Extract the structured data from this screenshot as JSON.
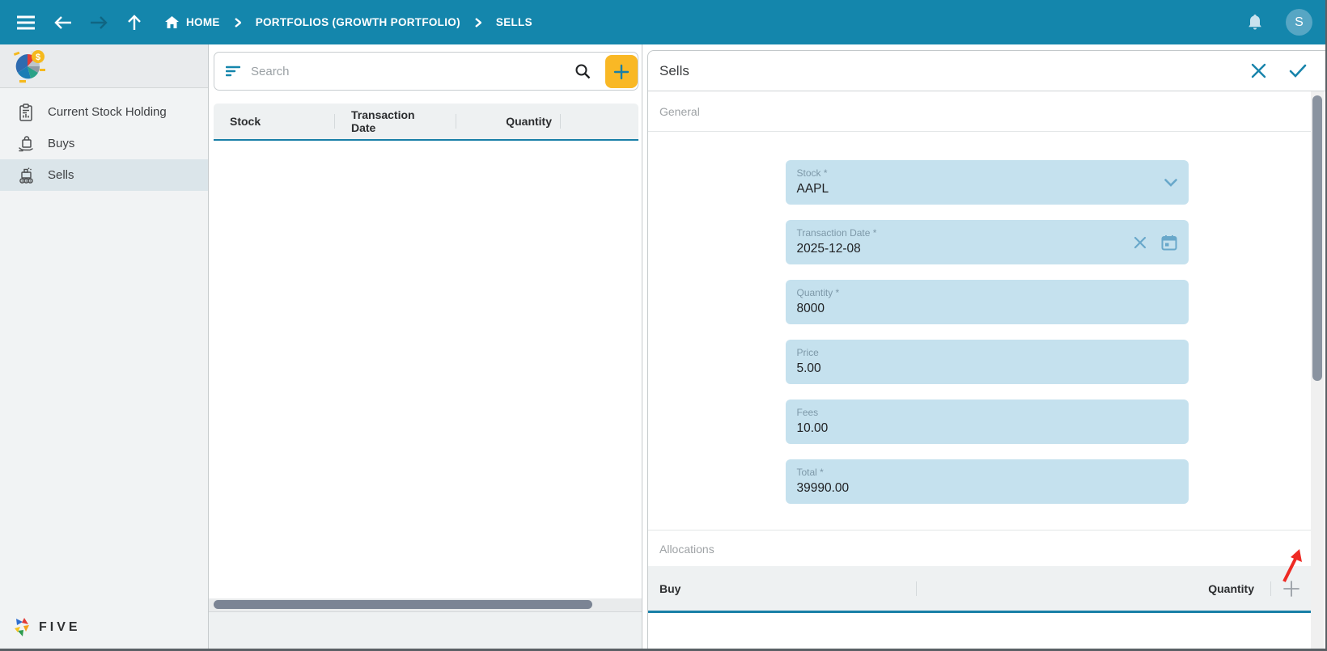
{
  "colors": {
    "topbar": "#1486ac",
    "accent": "#187fa7",
    "add-button": "#f9b825",
    "field-bg": "#c5e1ee",
    "annotation": "#ee2a24"
  },
  "topbar": {
    "breadcrumbs": [
      {
        "label": "HOME"
      },
      {
        "label": "PORTFOLIOS (GROWTH PORTFOLIO)"
      },
      {
        "label": "SELLS"
      }
    ],
    "avatar_initial": "S"
  },
  "sidebar": {
    "items": [
      {
        "label": "Current Stock Holding",
        "icon": "clipboard-report-icon",
        "selected": false
      },
      {
        "label": "Buys",
        "icon": "hand-bag-icon",
        "selected": false
      },
      {
        "label": "Sells",
        "icon": "register-coins-icon",
        "selected": true
      }
    ],
    "brand": "FIVE"
  },
  "list_panel": {
    "search": {
      "placeholder": "Search"
    },
    "columns": [
      "Stock",
      "Transaction Date",
      "Quantity"
    ],
    "rows": []
  },
  "detail_panel": {
    "title": "Sells",
    "general_section": "General",
    "fields": [
      {
        "label": "Stock *",
        "value": "AAPL"
      },
      {
        "label": "Transaction Date *",
        "value": "2025-12-08"
      },
      {
        "label": "Quantity *",
        "value": "8000"
      },
      {
        "label": "Price",
        "value": "5.00"
      },
      {
        "label": "Fees",
        "value": "10.00"
      },
      {
        "label": "Total *",
        "value": "39990.00"
      }
    ],
    "allocations_section": "Allocations",
    "allocations": {
      "columns": [
        "Buy",
        "Quantity"
      ],
      "rows": []
    }
  }
}
